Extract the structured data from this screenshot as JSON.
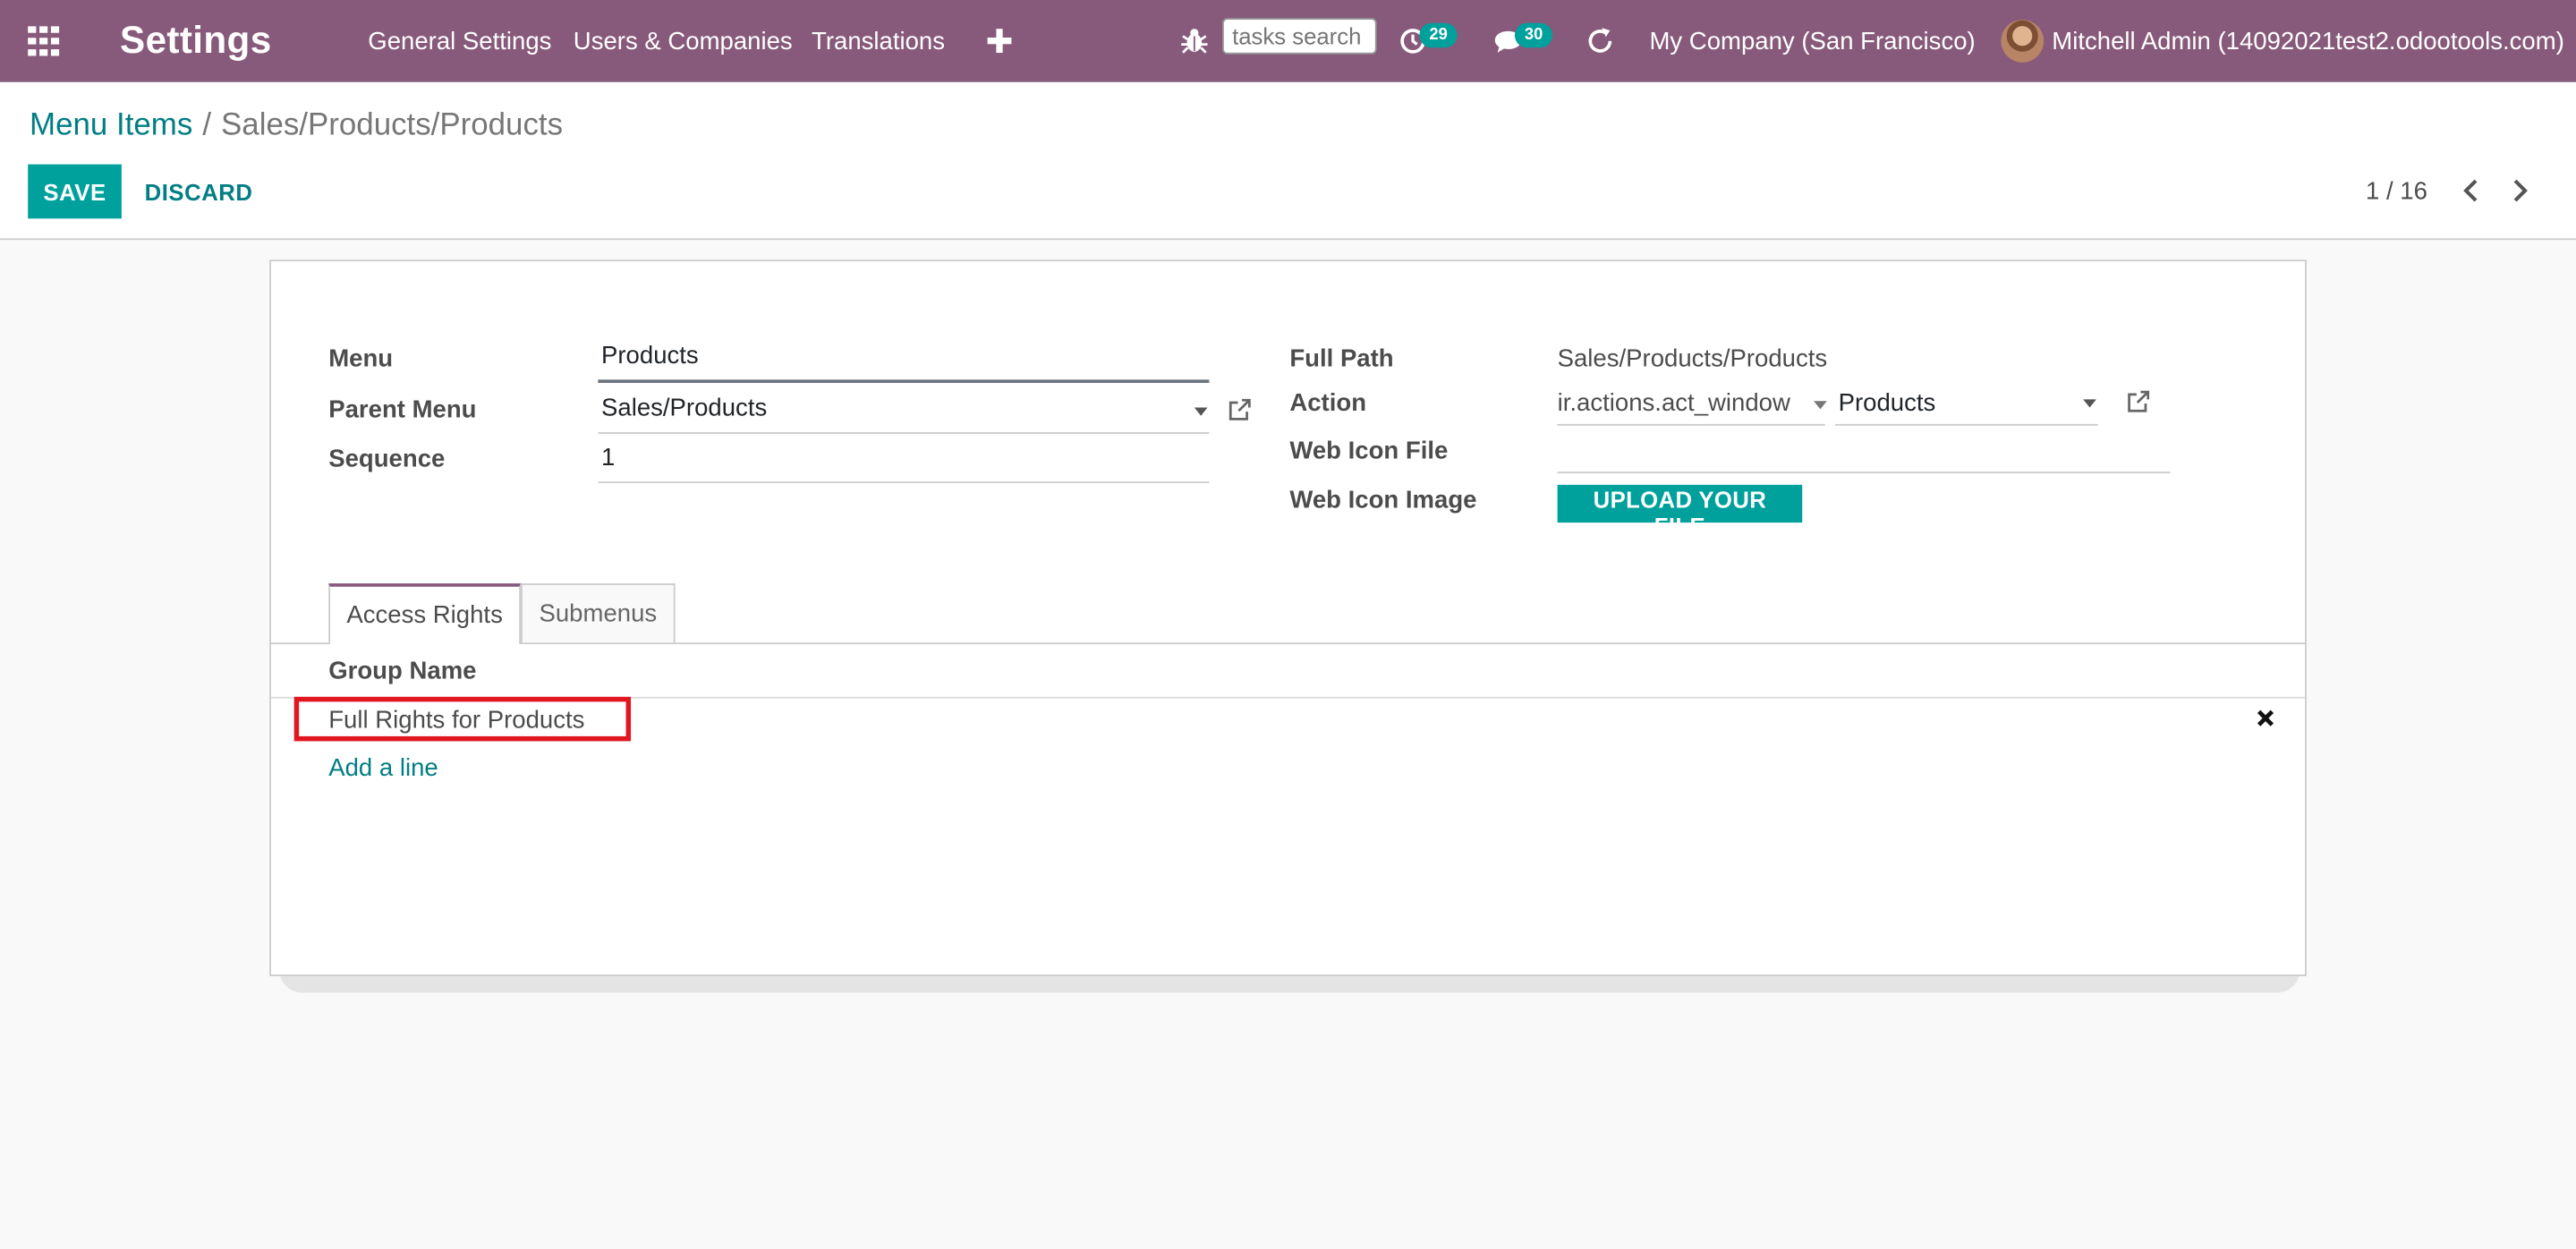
{
  "navbar": {
    "app_title": "Settings",
    "menus": [
      "General Settings",
      "Users & Companies",
      "Translations"
    ],
    "add_icon": "plus-icon",
    "search_placeholder": "tasks search",
    "activity_count": "29",
    "message_count": "30",
    "company": "My Company (San Francisco)",
    "user": "Mitchell Admin (14092021test2.odootools.com)",
    "colors": {
      "bar": "#875a7b",
      "badge": "#00a09d"
    }
  },
  "breadcrumb": {
    "parent": "Menu Items",
    "separator": "/",
    "current": "Sales/Products/Products"
  },
  "actions": {
    "save": "SAVE",
    "discard": "DISCARD"
  },
  "pager": {
    "value": "1 / 16"
  },
  "form": {
    "menu_label": "Menu",
    "menu_value": "Products",
    "parent_menu_label": "Parent Menu",
    "parent_menu_value": "Sales/Products",
    "sequence_label": "Sequence",
    "sequence_value": "1",
    "full_path_label": "Full Path",
    "full_path_value": "Sales/Products/Products",
    "action_label": "Action",
    "action_model": "ir.actions.act_window",
    "action_value": "Products",
    "web_icon_file_label": "Web Icon File",
    "web_icon_file_value": "",
    "web_icon_image_label": "Web Icon Image",
    "upload_button": "UPLOAD YOUR FILE"
  },
  "tabs": [
    {
      "label": "Access Rights",
      "active": true
    },
    {
      "label": "Submenus",
      "active": false
    }
  ],
  "access_rights": {
    "column_header": "Group Name",
    "rows": [
      "Full Rights for Products"
    ],
    "add_line": "Add a line"
  },
  "highlight_color": "#e2161f",
  "accent_color": "#00a09d"
}
